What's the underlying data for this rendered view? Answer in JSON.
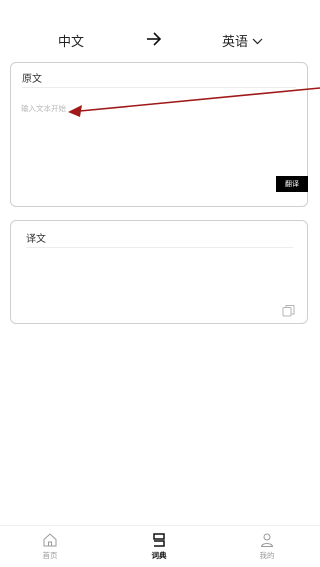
{
  "lang_bar": {
    "source_lang": "中文",
    "target_lang": "英语",
    "swap_icon": "arrow-right-icon",
    "dropdown_icon": "chevron-down-icon"
  },
  "source_card": {
    "title": "原文",
    "placeholder": "输入文本开始",
    "value": "",
    "translate_label": "翻译"
  },
  "target_card": {
    "title": "译文",
    "copy_icon": "copy-icon"
  },
  "tabs": [
    {
      "label": "首页",
      "icon": "home-icon",
      "active": false
    },
    {
      "label": "词典",
      "icon": "dictionary-icon",
      "active": true
    },
    {
      "label": "我的",
      "icon": "user-icon",
      "active": false
    }
  ],
  "colors": {
    "accent": "#000000",
    "annotation_arrow": "#a01818",
    "border": "#cfcfcf",
    "inactive_tab": "#999999"
  }
}
